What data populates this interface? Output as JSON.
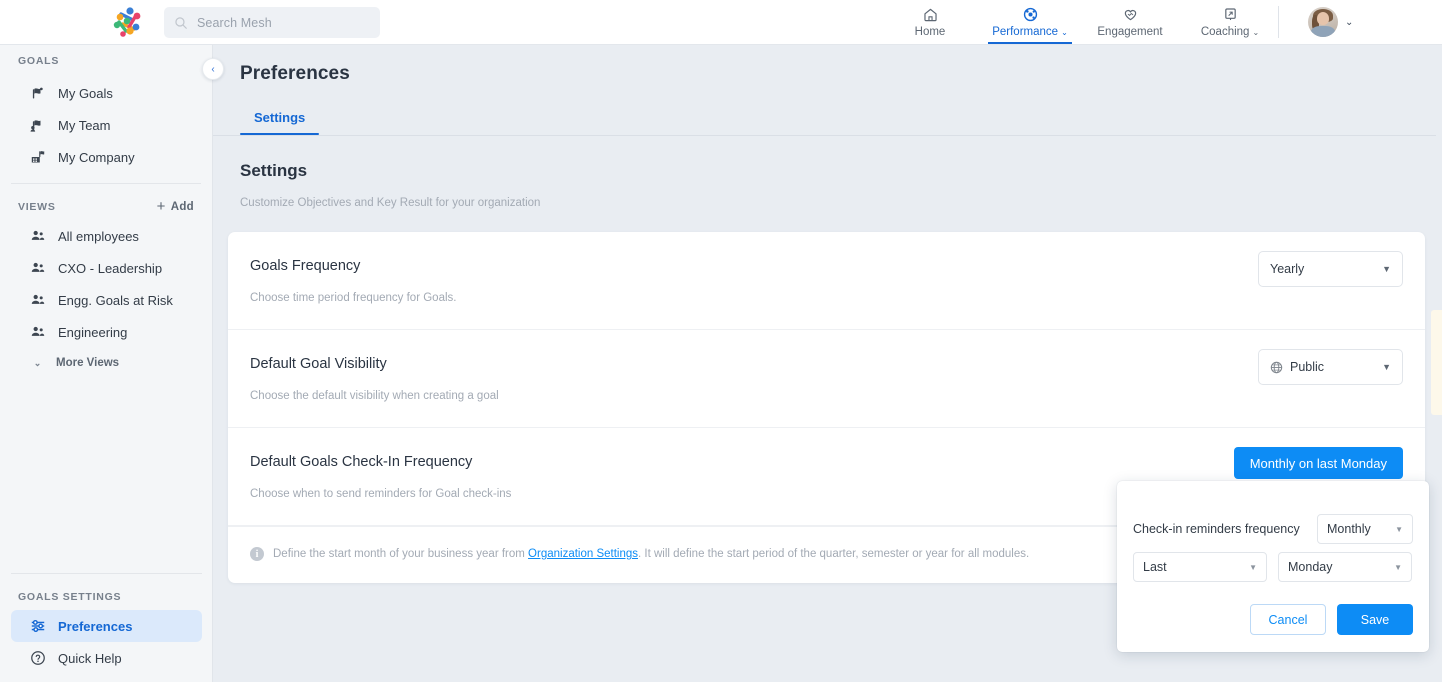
{
  "topbar": {
    "logo_name": "mesh-logo",
    "search": {
      "placeholder": "Search Mesh",
      "icon": "search-icon",
      "value": ""
    },
    "nav": [
      {
        "label": "Home",
        "icon": "home-icon",
        "active": false,
        "has_caret": false
      },
      {
        "label": "Performance",
        "icon": "performance-icon",
        "active": true,
        "has_caret": true,
        "caret": "⌄"
      },
      {
        "label": "Engagement",
        "icon": "engagement-icon",
        "active": false,
        "has_caret": false
      },
      {
        "label": "Coaching",
        "icon": "coaching-icon",
        "active": false,
        "has_caret": true,
        "caret": "⌄"
      }
    ],
    "profile": {
      "avatar_name": "user-avatar",
      "caret": "⌄"
    }
  },
  "sidebar": {
    "collapse_icon": "‹",
    "sections": [
      {
        "label": "GOALS",
        "items": [
          {
            "label": "My Goals",
            "icon": "goal-flag-icon",
            "selected": false
          },
          {
            "label": "My Team",
            "icon": "team-goal-icon",
            "selected": false
          },
          {
            "label": "My Company",
            "icon": "company-goal-icon",
            "selected": false
          }
        ]
      },
      {
        "label": "VIEWS",
        "action": {
          "label": "Add",
          "icon": "plus-icon"
        },
        "items": [
          {
            "label": "All employees",
            "icon": "people-icon",
            "selected": false
          },
          {
            "label": "CXO - Leadership",
            "icon": "people-icon",
            "selected": false
          },
          {
            "label": "Engg. Goals at Risk",
            "icon": "people-icon",
            "selected": false
          },
          {
            "label": "Engineering",
            "icon": "people-icon",
            "selected": false
          }
        ],
        "more": {
          "label": "More Views",
          "icon": "chevron-down-icon",
          "chevron": "⌄"
        }
      }
    ],
    "bottom_section": {
      "label": "GOALS SETTINGS",
      "items": [
        {
          "label": "Preferences",
          "icon": "sliders-icon",
          "selected": true
        },
        {
          "label": "Quick Help",
          "icon": "question-circle-icon",
          "selected": false
        }
      ]
    }
  },
  "page": {
    "title": "Preferences",
    "tabs": [
      {
        "label": "Settings",
        "active": true
      }
    ],
    "settings_title": "Settings",
    "settings_subtitle": "Customize Objectives and Key Result for your organization"
  },
  "settings_rows": [
    {
      "title": "Goals Frequency",
      "desc": "Choose time period frequency for Goals.",
      "control": {
        "kind": "select",
        "name": "goals-frequency-select",
        "value": "Yearly",
        "caret": "▼",
        "icon": null
      }
    },
    {
      "title": "Default Goal Visibility",
      "desc": "Choose the default visibility when creating a goal",
      "control": {
        "kind": "select",
        "name": "default-goal-visibility-select",
        "value": "Public",
        "caret": "▼",
        "icon": "globe-icon"
      }
    },
    {
      "title": "Default Goals Check-In Frequency",
      "desc": "Choose when to send reminders for Goal check-ins",
      "control": {
        "kind": "button",
        "name": "checkin-frequency-button",
        "value": "Monthly on last Monday"
      }
    }
  ],
  "note": {
    "icon": "info-icon",
    "icon_glyph": "i",
    "text_before": "Define the start month of your business year from ",
    "link": "Organization Settings",
    "text_after": ". It will define the start period of the quarter, semester or year for all modules."
  },
  "popover": {
    "frequency_label": "Check-in reminders frequency",
    "frequency_value": "Monthly",
    "ordinal_value": "Last",
    "weekday_value": "Monday",
    "caret": "▼",
    "cancel_label": "Cancel",
    "save_label": "Save"
  },
  "colors": {
    "accent_blue": "#0d8cf5",
    "nav_blue": "#1568d4",
    "page_bg": "#e9edf2",
    "sidebar_bg": "#f4f6f8",
    "card_bg": "#ffffff",
    "edge_tab": "#fdf8ea"
  }
}
